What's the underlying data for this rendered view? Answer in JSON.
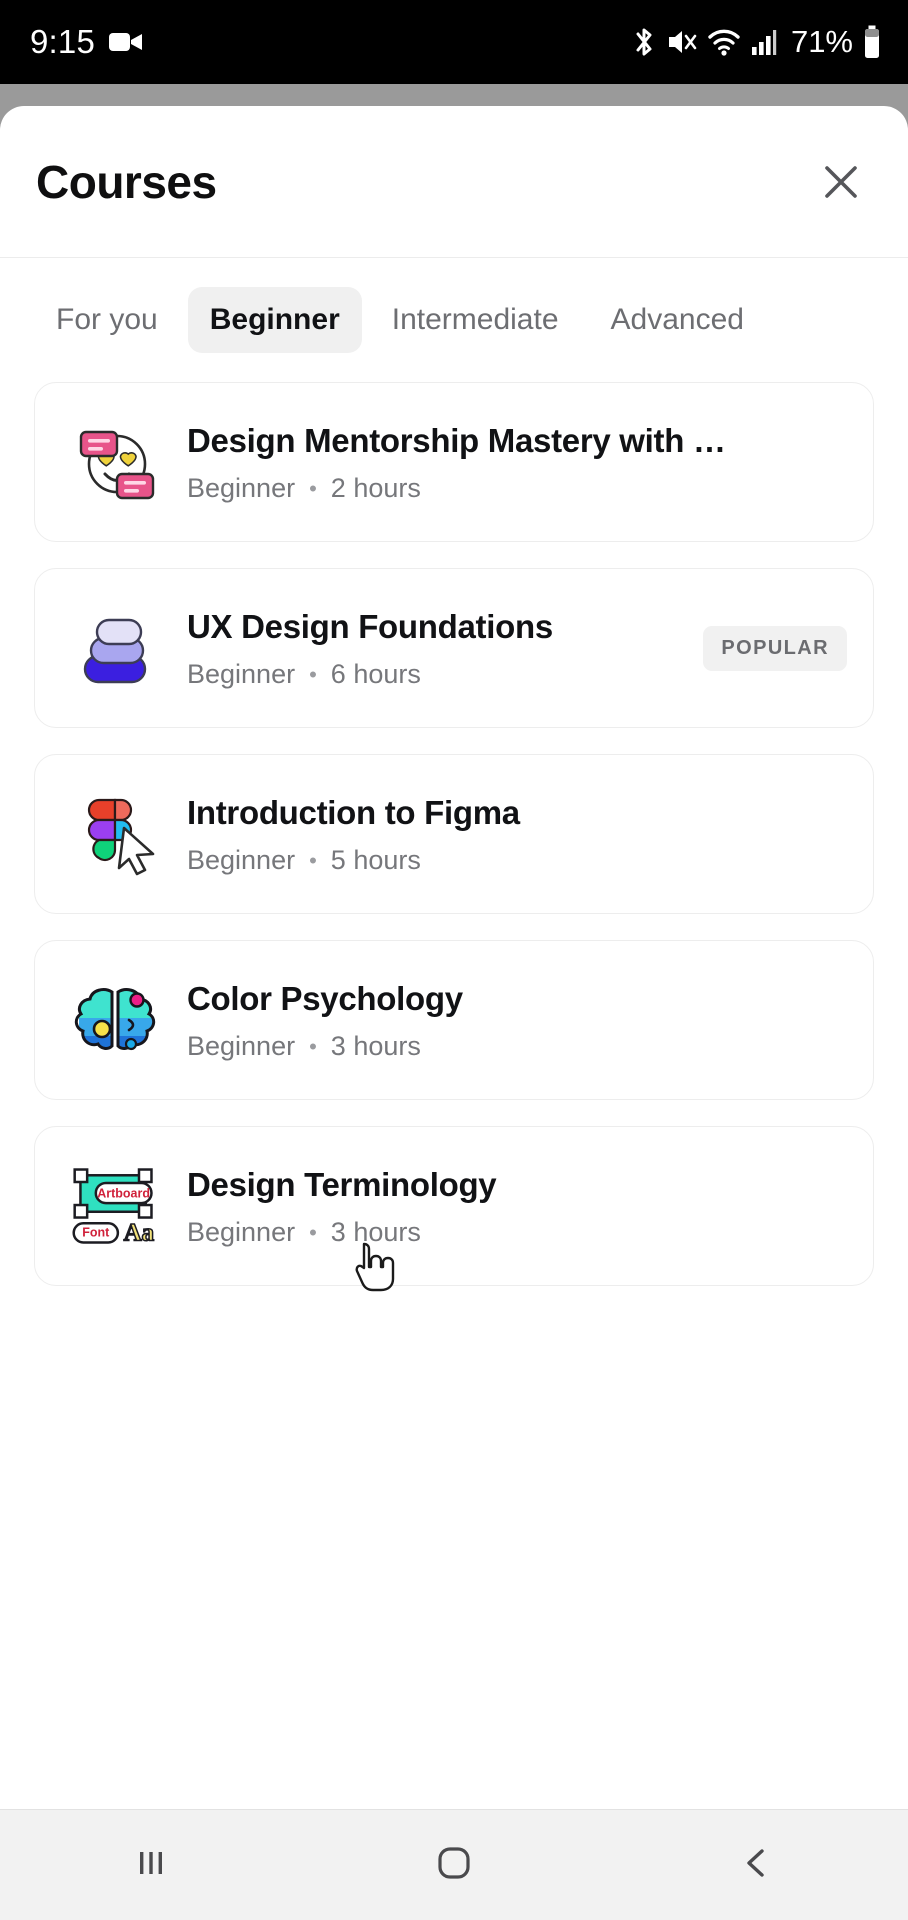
{
  "status_bar": {
    "time": "9:15",
    "recording_icon": "video-camera-icon",
    "bluetooth_icon": "bluetooth-icon",
    "mute_icon": "volume-mute-icon",
    "wifi_icon": "wifi-icon",
    "signal_icon": "cellular-signal-icon",
    "battery_percent": "71%",
    "battery_icon": "battery-icon",
    "bg_color": "#000000",
    "fg_color": "#ffffff"
  },
  "sheet": {
    "title": "Courses",
    "close_icon": "close-x-icon"
  },
  "tabs": {
    "items": [
      {
        "label": "For you",
        "active": false
      },
      {
        "label": "Beginner",
        "active": true
      },
      {
        "label": "Intermediate",
        "active": false
      },
      {
        "label": "Advanced",
        "active": false
      }
    ],
    "active_index": 1,
    "active_bg": "#f0f0f0"
  },
  "courses": [
    {
      "title": "Design Mentorship Mastery with …",
      "level": "Beginner",
      "separator": "•",
      "duration": "2 hours",
      "badge": "",
      "icon": "smiley-heart-eyes-chat-icon"
    },
    {
      "title": "UX Design Foundations",
      "level": "Beginner",
      "separator": "•",
      "duration": "6 hours",
      "badge": "POPULAR",
      "icon": "stacked-layers-icon"
    },
    {
      "title": "Introduction to Figma",
      "level": "Beginner",
      "separator": "•",
      "duration": "5 hours",
      "badge": "",
      "icon": "figma-logo-cursor-icon"
    },
    {
      "title": "Color Psychology",
      "level": "Beginner",
      "separator": "•",
      "duration": "3 hours",
      "badge": "",
      "icon": "brain-icon"
    },
    {
      "title": "Design Terminology",
      "level": "Beginner",
      "separator": "•",
      "duration": "3 hours",
      "badge": "",
      "icon": "artboard-font-icon",
      "icon_labels": {
        "artboard": "Artboard",
        "font": "Font",
        "aa": "Aa"
      }
    }
  ],
  "nav_bar": {
    "recents_icon": "recents-lines-icon",
    "home_icon": "home-circle-icon",
    "back_icon": "back-chevron-icon",
    "bg_color": "#f2f2f2"
  },
  "cursor": {
    "icon": "hand-pointer-cursor"
  }
}
